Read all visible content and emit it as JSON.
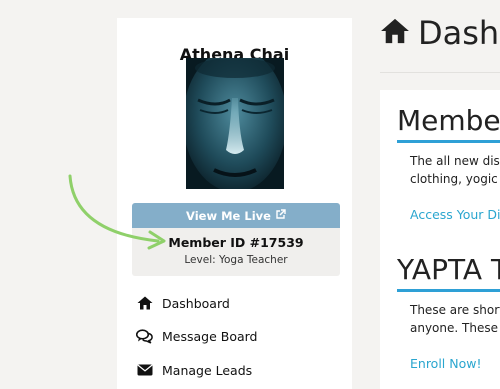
{
  "profile": {
    "name": "Athena Chai",
    "view_live_label": "View Me Live",
    "member_id": "Member ID #17539",
    "level": "Level: Yoga Teacher"
  },
  "nav": {
    "items": [
      {
        "label": "Dashboard",
        "icon": "home-icon"
      },
      {
        "label": "Message Board",
        "icon": "comments-icon"
      },
      {
        "label": "Manage Leads",
        "icon": "envelope-icon"
      }
    ]
  },
  "main": {
    "title": "Dashb",
    "sections": [
      {
        "title": "Member",
        "lines": [
          "The all new disc",
          "clothing, yogic p"
        ],
        "link": "Access Your Dis"
      },
      {
        "title": "YAPTA Ta",
        "lines": [
          "These are short",
          "anyone. These"
        ],
        "link": "Enroll Now!"
      }
    ]
  },
  "colors": {
    "page_bg": "#f4f3f1",
    "button": "#84aec9",
    "accent": "#2ea0d6",
    "link": "#2aa6cf",
    "annotation_arrow": "#8fd06a"
  }
}
